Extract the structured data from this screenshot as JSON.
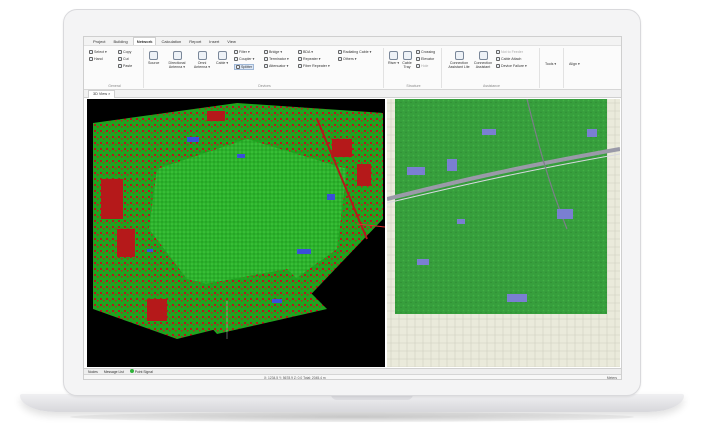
{
  "menu": {
    "tabs": [
      "Project",
      "Building",
      "Network",
      "Calculation",
      "Report",
      "Insert",
      "View"
    ],
    "active": "Network"
  },
  "ribbon": {
    "general": {
      "label": "General",
      "select": "Select ▾",
      "hand": "Hand",
      "copy": "Copy",
      "cut": "Cut",
      "paste": "Paste"
    },
    "devices": {
      "label": "Devices",
      "source": "Source",
      "directional_antenna": "Directional Antenna ▾",
      "omni_antenna": "Omni Antenna ▾",
      "cable": "Cable ▾",
      "filter": "Filter ▾",
      "coupler": "Coupler ▾",
      "splitter": "Splitter",
      "bridge": "Bridge ▾",
      "terminator": "Terminator ▾",
      "attenuator": "Attenuator ▾",
      "bda": "BDA ▾",
      "repeater": "Repeater ▾",
      "fiber_repeater": "Fiber Repeater ▾",
      "radiating_cable": "Radiating Cable ▾",
      "others": "Others ▾"
    },
    "structure": {
      "label": "Structure",
      "riser": "Riser ▾",
      "cable_tray": "Cable Tray",
      "crossing": "Crossing",
      "elevator": "Elevator",
      "hole": "Hole"
    },
    "assistance": {
      "label": "Assistance",
      "conn_lite": "Connection Assistant Lite",
      "conn": "Connection Assistant",
      "not_feeder": "Not to Feeder",
      "cable_attach": "Cable Attach",
      "device_failure": "Device Failure ▾"
    },
    "tools": "Tools ▾",
    "align": "Align ▾"
  },
  "view_tab": "3D View",
  "message_bar": {
    "nodes": "Nodes",
    "message_list": "Message List",
    "point_signal": "Point Signal"
  },
  "status": {
    "center": "X: 1234.5   Y: 5678.9   Z: 0.0   Total: 2045.4 m",
    "right": "Meters"
  },
  "colors": {
    "terrain": "#1fa31f",
    "building": "#c01a1a",
    "water": "#3a4fd8",
    "map_bg": "#e9eadd"
  }
}
